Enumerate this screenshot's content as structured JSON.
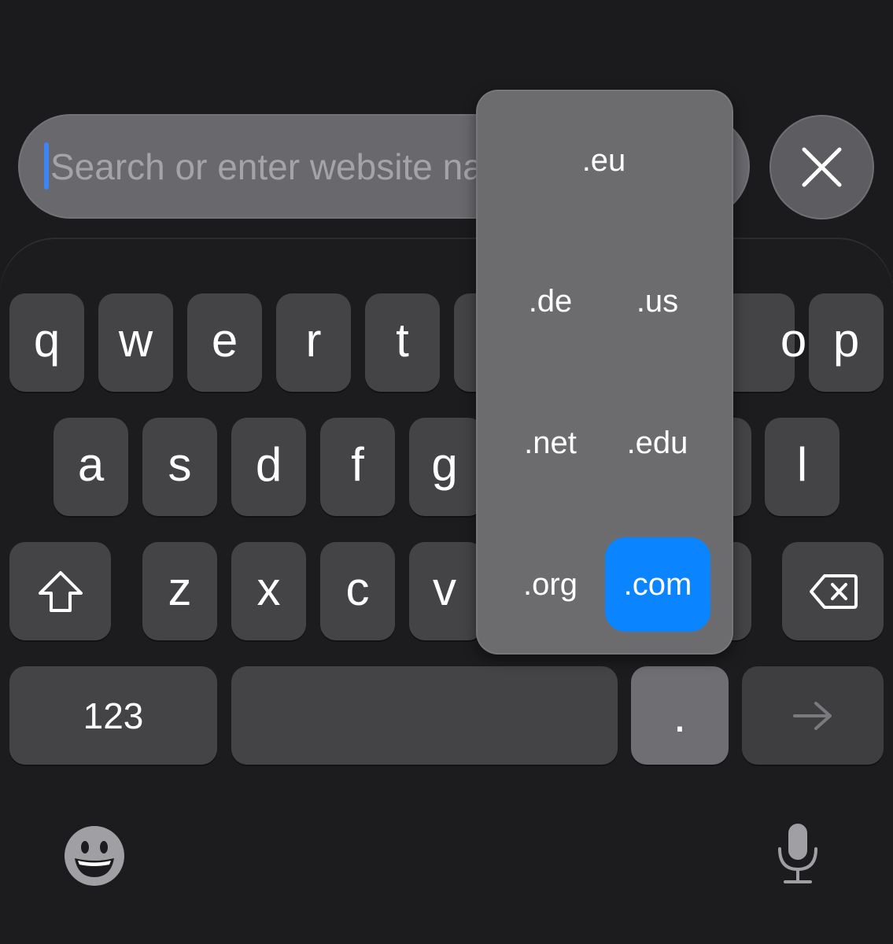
{
  "search": {
    "placeholder": "Search or enter website name"
  },
  "close_icon": "close-icon",
  "domains": {
    "items": [
      {
        "label": ".eu"
      },
      {
        "label": ".de"
      },
      {
        "label": ".us"
      },
      {
        "label": ".net"
      },
      {
        "label": ".edu"
      },
      {
        "label": ".org"
      },
      {
        "label": ".com",
        "selected": true
      }
    ]
  },
  "keys": {
    "row1": [
      "q",
      "w",
      "e",
      "r",
      "t",
      "o",
      "p"
    ],
    "row2": [
      "a",
      "s",
      "d",
      "f",
      "g",
      "l"
    ],
    "row3": [
      "z",
      "x",
      "c",
      "v"
    ],
    "numbers": "123",
    "period": ".",
    "shift_icon": "shift-icon",
    "backspace_icon": "backspace-icon",
    "return_icon": "return-arrow-icon",
    "emoji_icon": "emoji-icon",
    "mic_icon": "microphone-icon"
  },
  "colors": {
    "accent": "#0a84ff",
    "cursor": "#3d84f7",
    "key": "#444447",
    "background": "#1b1b1e"
  }
}
